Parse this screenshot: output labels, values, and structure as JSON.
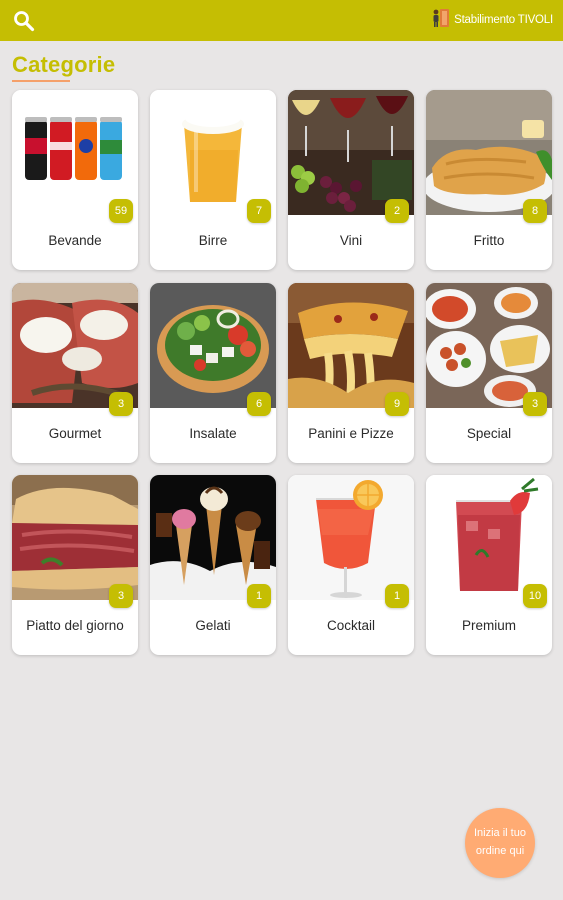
{
  "header": {
    "venue_name": "Stabilimento TIVOLI",
    "background": "#c5be03",
    "search_icon": "search-icon",
    "venue_icon": "waiter-icon"
  },
  "page": {
    "title": "Categorie",
    "accent": "#c5be03",
    "underline_color": "#f5a06a"
  },
  "categories": [
    {
      "label": "Bevande",
      "count": "59",
      "image": "soda-cans"
    },
    {
      "label": "Birre",
      "count": "7",
      "image": "beer-glass"
    },
    {
      "label": "Vini",
      "count": "2",
      "image": "wine-glasses"
    },
    {
      "label": "Fritto",
      "count": "8",
      "image": "fried-cutlet"
    },
    {
      "label": "Gourmet",
      "count": "3",
      "image": "carpaccio-mozzarella"
    },
    {
      "label": "Insalate",
      "count": "6",
      "image": "salad-bowl"
    },
    {
      "label": "Panini e Pizze",
      "count": "9",
      "image": "pizza-cheese"
    },
    {
      "label": "Special",
      "count": "3",
      "image": "tapas-dishes"
    },
    {
      "label": "Piatto del giorno",
      "count": "3",
      "image": "roast-beef-sandwich"
    },
    {
      "label": "Gelati",
      "count": "1",
      "image": "ice-cream-cones"
    },
    {
      "label": "Cocktail",
      "count": "1",
      "image": "spritz-cocktail"
    },
    {
      "label": "Premium",
      "count": "10",
      "image": "red-drink"
    }
  ],
  "fab": {
    "line1": "Inizia il tuo",
    "line2": "ordine qui",
    "color": "#ffab73"
  }
}
